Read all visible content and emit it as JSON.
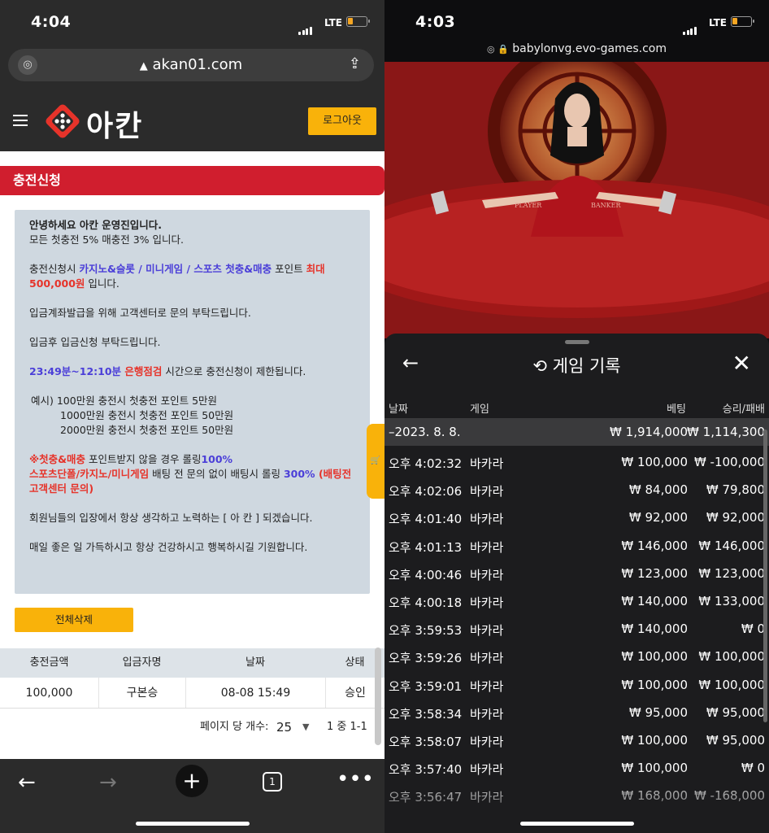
{
  "left": {
    "status": {
      "time": "4:04",
      "network": "LTE"
    },
    "browser": {
      "url": "akan01.com"
    },
    "header": {
      "logo": "아칸",
      "logout_label": "로그아웃"
    },
    "section_title": "충전신청",
    "notice": {
      "greeting": "안녕하세요 아칸 운영진입니다.",
      "line1": "모든 첫충전 5% 매충전 3% 입니다.",
      "p2_a": "충전신청시 ",
      "p2_b": "카지노&슬롯 / 미니게임 / 스포츠 첫충&매충",
      "p2_c": " 포인트 ",
      "p2_d": "최대 500,000원",
      "p2_e": " 입니다.",
      "p3": "입금계좌발급을 위해 고객센터로 문의 부탁드립니다.",
      "p4": "입금후 입금신청 부탁드립니다.",
      "p5_a": "23:49분~12:10분",
      "p5_b": " 은행점검",
      "p5_c": " 시간으로 충전신청이 제한됩니다.",
      "ex1": "예시)  100만원 충전시 첫충전 포인트 5만원",
      "ex2": "1000만원 충전시 첫충전 포인트 50만원",
      "ex3": "2000만원 충전시 첫충전 포인트 50만원",
      "p7_a": "※첫충&매충",
      "p7_b": " 포인트받지 않을 경우 롤링",
      "p7_c": "100%",
      "p7_d": "스포츠단폴/카지노/미니게임",
      "p7_e": " 배팅 전 문의 없이 배팅시 롤링 ",
      "p7_f": "300%",
      "p7_g": " (배팅전 고객센터 문의)",
      "p8": "회원님들의 입장에서 항상 생각하고 노력하는 [ 아 칸 ] 되겠습니다.",
      "p9": "매일 좋은 일 가득하시고 항상 건강하시고 행복하시길 기원합니다."
    },
    "delete_all_label": "전체삭제",
    "table": {
      "headers": [
        "충전금액",
        "입금자명",
        "날짜",
        "상태"
      ],
      "rows": [
        [
          "100,000",
          "구본승",
          "08-08 15:49",
          "승인"
        ]
      ]
    },
    "pager": {
      "per_page_label": "페이지 당 개수:",
      "per_page": "25",
      "range": "1 중 1-1"
    },
    "nav": {
      "tabs_count": "1"
    }
  },
  "right": {
    "status": {
      "time": "4:03",
      "network": "LTE"
    },
    "browser": {
      "url": "babylonvg.evo-games.com"
    },
    "table_labels": {
      "player": "PLAYER",
      "banker": "BANKER"
    },
    "panel": {
      "title": "게임 기록",
      "headers": {
        "date": "날짜",
        "game": "게임",
        "bet": "베팅",
        "result": "승리/패배"
      },
      "date_row": {
        "date": "–2023. 8. 8.",
        "bet": "₩ 1,914,000",
        "result": "₩ 1,114,300"
      },
      "rows": [
        {
          "time": "오후 4:02:32",
          "game": "바카라",
          "bet": "₩ 100,000",
          "result": "₩ -100,000"
        },
        {
          "time": "오후 4:02:06",
          "game": "바카라",
          "bet": "₩ 84,000",
          "result": "₩ 79,800"
        },
        {
          "time": "오후 4:01:40",
          "game": "바카라",
          "bet": "₩ 92,000",
          "result": "₩ 92,000"
        },
        {
          "time": "오후 4:01:13",
          "game": "바카라",
          "bet": "₩ 146,000",
          "result": "₩ 146,000"
        },
        {
          "time": "오후 4:00:46",
          "game": "바카라",
          "bet": "₩ 123,000",
          "result": "₩ 123,000"
        },
        {
          "time": "오후 4:00:18",
          "game": "바카라",
          "bet": "₩ 140,000",
          "result": "₩ 133,000"
        },
        {
          "time": "오후 3:59:53",
          "game": "바카라",
          "bet": "₩ 140,000",
          "result": "₩ 0"
        },
        {
          "time": "오후 3:59:26",
          "game": "바카라",
          "bet": "₩ 100,000",
          "result": "₩ 100,000"
        },
        {
          "time": "오후 3:59:01",
          "game": "바카라",
          "bet": "₩ 100,000",
          "result": "₩ 100,000"
        },
        {
          "time": "오후 3:58:34",
          "game": "바카라",
          "bet": "₩ 95,000",
          "result": "₩ 95,000"
        },
        {
          "time": "오후 3:58:07",
          "game": "바카라",
          "bet": "₩ 100,000",
          "result": "₩ 95,000"
        },
        {
          "time": "오후 3:57:40",
          "game": "바카라",
          "bet": "₩ 100,000",
          "result": "₩ 0"
        },
        {
          "time": "오후 3:56:47",
          "game": "바카라",
          "bet": "₩ 168,000",
          "result": "₩ -168,000"
        }
      ]
    }
  },
  "colors": {
    "accent_yellow": "#f9b20a",
    "header_red": "#d01e2e",
    "dark": "#2b2b2b",
    "panel": "#1c1c1e"
  }
}
